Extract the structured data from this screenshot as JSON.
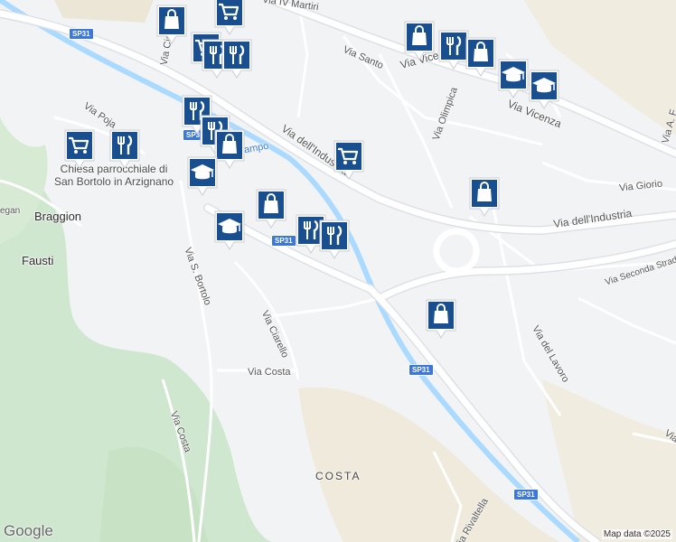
{
  "map": {
    "colors": {
      "background": "#f2f3f5",
      "park": "#cfe6cf",
      "river": "#aadaff",
      "road": "#ffffff",
      "marker": "#1a4f8f"
    },
    "road_labels": {
      "via_iv_martiri": "Via IV Martiri",
      "via_santo": "Via Santo",
      "via_vicenza_1": "Via Vicenza",
      "via_vicenza_2": "Via Vicenza",
      "via_olimpica": "Via Olimpica",
      "via_industria_1": "Via dell'Industria",
      "via_industria_2": "Via dell'Industria",
      "via_giorio": "Via Giorio",
      "via_seconda_strada": "Via Seconda Strada",
      "via_poja": "Via Poja",
      "via_s_bortolo": "Via S. Bortolo",
      "via_ciarello": "Via Ciarello",
      "via_costa_1": "Via Costa",
      "via_costa_2": "Via Costa",
      "via_del_lavoro": "Via del Lavoro",
      "via_rivaltella": "Via Rivaltella",
      "via_a": "Via A. F",
      "via_v": "Via V",
      "via_cir": "Via Cir",
      "campo": "ampo",
      "regan": "egan"
    },
    "route_shields": [
      "SP31",
      "SP31",
      "SP31",
      "SP31",
      "SP31"
    ],
    "place_labels": {
      "braggion": "Braggion",
      "fausti": "Fausti",
      "costa": "COSTA"
    },
    "poi_label": {
      "line1": "Chiesa parrocchiale di",
      "line2": "San Bortolo in Arzignano"
    },
    "markers": [
      {
        "icon": "shopping-bag-icon"
      },
      {
        "icon": "shopping-cart-icon"
      },
      {
        "icon": "shopping-cart-icon"
      },
      {
        "icon": "restaurant-icon"
      },
      {
        "icon": "restaurant-icon"
      },
      {
        "icon": "shopping-bag-icon"
      },
      {
        "icon": "restaurant-icon"
      },
      {
        "icon": "shopping-bag-icon"
      },
      {
        "icon": "school-icon"
      },
      {
        "icon": "school-icon"
      },
      {
        "icon": "restaurant-icon"
      },
      {
        "icon": "restaurant-icon"
      },
      {
        "icon": "shopping-cart-icon"
      },
      {
        "icon": "restaurant-icon"
      },
      {
        "icon": "shopping-bag-icon"
      },
      {
        "icon": "shopping-cart-icon"
      },
      {
        "icon": "school-icon"
      },
      {
        "icon": "shopping-bag-icon"
      },
      {
        "icon": "shopping-bag-icon"
      },
      {
        "icon": "school-icon"
      },
      {
        "icon": "restaurant-icon"
      },
      {
        "icon": "restaurant-icon"
      },
      {
        "icon": "shopping-bag-icon"
      }
    ],
    "attribution": {
      "brand": "Google",
      "copyright": "Map data ©2025"
    }
  }
}
